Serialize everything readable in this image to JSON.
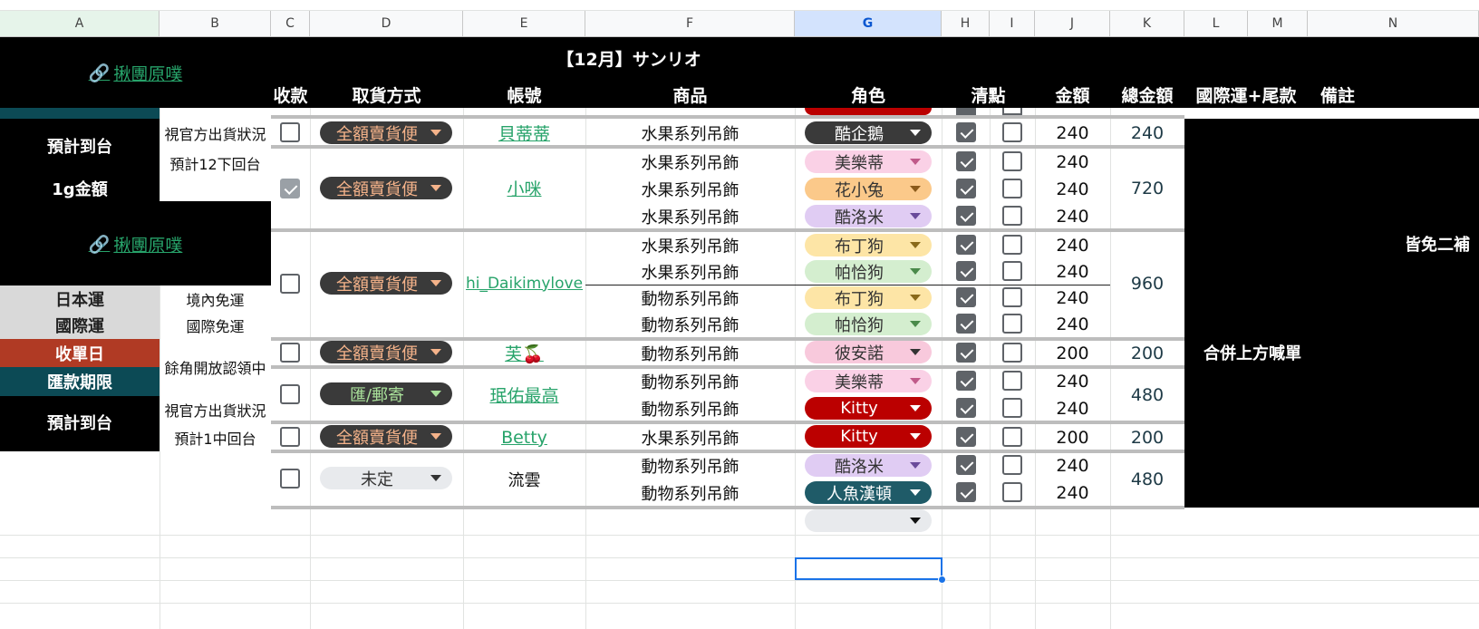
{
  "columns": [
    "A",
    "B",
    "C",
    "D",
    "E",
    "F",
    "G",
    "H",
    "I",
    "J",
    "K",
    "L",
    "M",
    "N"
  ],
  "header": {
    "link": "揪團原噗",
    "title": "【12月】サンリオ",
    "cols": {
      "pay": "收款",
      "method": "取貨方式",
      "account": "帳號",
      "item": "商品",
      "role": "角色",
      "check": "清點",
      "amount": "金額",
      "total": "總金額",
      "intl": "國際運+尾款",
      "note": "備註"
    }
  },
  "left": {
    "est_arrival": "預計到台",
    "official_status": "視官方出貨狀況",
    "est_dec": "預計12下回台",
    "gram_fee": "1g金額",
    "link2": "揪團原噗",
    "jp_ship": "日本運",
    "jp_ship_val": "境內免運",
    "intl_ship": "國際運",
    "intl_ship_val": "國際免運",
    "close_day": "收單日",
    "pay_deadline": "匯款期限",
    "leftover": "餘角開放認領中",
    "est_arrival2": "預計到台",
    "official_status2": "視官方出貨狀況",
    "est_jan": "預計1中回台"
  },
  "rows": [
    {
      "pay": false,
      "method": "全額賣貨便",
      "account": "貝蒂蒂",
      "items": [
        {
          "item": "水果系列吊飾",
          "role": "酷企鵝",
          "amount": "240"
        }
      ],
      "total": "240"
    },
    {
      "pay": true,
      "method": "全額賣貨便",
      "account": "小咪",
      "items": [
        {
          "item": "水果系列吊飾",
          "role": "美樂蒂",
          "amount": "240"
        },
        {
          "item": "水果系列吊飾",
          "role": "花小兔",
          "amount": "240"
        },
        {
          "item": "水果系列吊飾",
          "role": "酷洛米",
          "amount": "240"
        }
      ],
      "total": "720"
    },
    {
      "pay": false,
      "method": "全額賣貨便",
      "account": "hi_Daikimylove",
      "items": [
        {
          "item": "水果系列吊飾",
          "role": "布丁狗",
          "amount": "240"
        },
        {
          "item": "水果系列吊飾",
          "role": "帕恰狗",
          "amount": "240"
        },
        {
          "item": "動物系列吊飾",
          "role": "布丁狗",
          "amount": "240"
        },
        {
          "item": "動物系列吊飾",
          "role": "帕恰狗",
          "amount": "240"
        }
      ],
      "total": "960"
    },
    {
      "pay": false,
      "method": "全額賣貨便",
      "account": "芙🍒",
      "items": [
        {
          "item": "動物系列吊飾",
          "role": "彼安諾",
          "amount": "200"
        }
      ],
      "total": "200"
    },
    {
      "pay": false,
      "method": "匯/郵寄",
      "account": "珉佑最高",
      "items": [
        {
          "item": "動物系列吊飾",
          "role": "美樂蒂",
          "amount": "240"
        },
        {
          "item": "動物系列吊飾",
          "role": "Kitty",
          "amount": "240"
        }
      ],
      "total": "480"
    },
    {
      "pay": false,
      "method": "全額賣貨便",
      "account": "Betty",
      "items": [
        {
          "item": "水果系列吊飾",
          "role": "Kitty",
          "amount": "200"
        }
      ],
      "total": "200"
    },
    {
      "pay": false,
      "method": "未定",
      "account": "流雲",
      "items": [
        {
          "item": "動物系列吊飾",
          "role": "酷洛米",
          "amount": "240"
        },
        {
          "item": "動物系列吊飾",
          "role": "人魚漢頓",
          "amount": "240"
        }
      ],
      "total": "480"
    }
  ],
  "notes": {
    "merge": "合併上方喊單",
    "no_second": "皆免二補"
  },
  "colors": {
    "green_link": "#27a36a",
    "dark_chip": "#3a3a3a",
    "peach_text": "#f5b38a",
    "teal": "#0c4a55",
    "rust": "#b03a24"
  }
}
